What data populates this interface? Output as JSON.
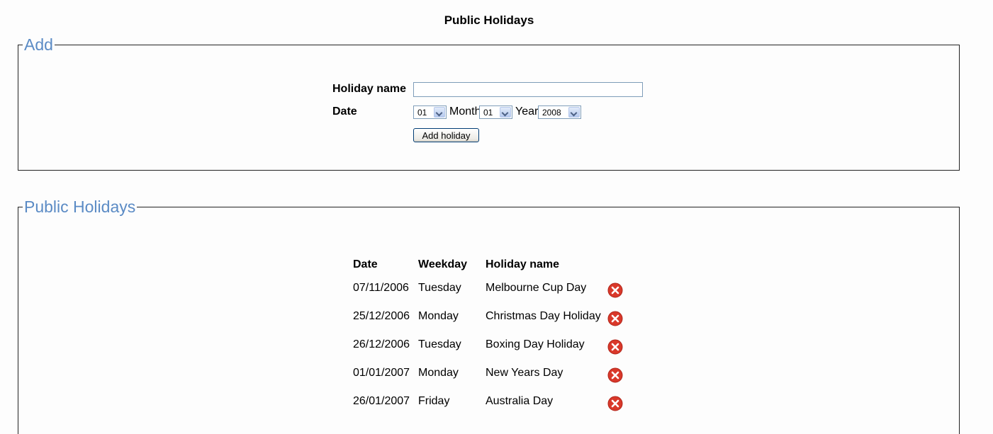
{
  "page": {
    "title": "Public Holidays"
  },
  "add_section": {
    "legend": "Add",
    "holiday_name_label": "Holiday name",
    "holiday_name_value": "",
    "date_label": "Date",
    "day_value": "01",
    "month_label": "Month",
    "month_value": "01",
    "year_label": "Year",
    "year_value": "2008",
    "add_button_label": "Add holiday"
  },
  "list_section": {
    "legend": "Public Holidays",
    "headers": {
      "date": "Date",
      "weekday": "Weekday",
      "name": "Holiday name"
    },
    "rows": [
      {
        "date": "07/11/2006",
        "weekday": "Tuesday",
        "name": "Melbourne Cup Day",
        "action_icon": "delete-icon"
      },
      {
        "date": "25/12/2006",
        "weekday": "Monday",
        "name": "Christmas Day Holiday",
        "action_icon": "delete-icon"
      },
      {
        "date": "26/12/2006",
        "weekday": "Tuesday",
        "name": "Boxing Day Holiday",
        "action_icon": "delete-icon"
      },
      {
        "date": "01/01/2007",
        "weekday": "Monday",
        "name": "New Years Day",
        "action_icon": "delete-icon"
      },
      {
        "date": "26/01/2007",
        "weekday": "Friday",
        "name": "Australia Day",
        "action_icon": "delete-icon"
      }
    ]
  },
  "colors": {
    "legend": "#5b8bc5",
    "delete_icon": "#d9382a"
  }
}
